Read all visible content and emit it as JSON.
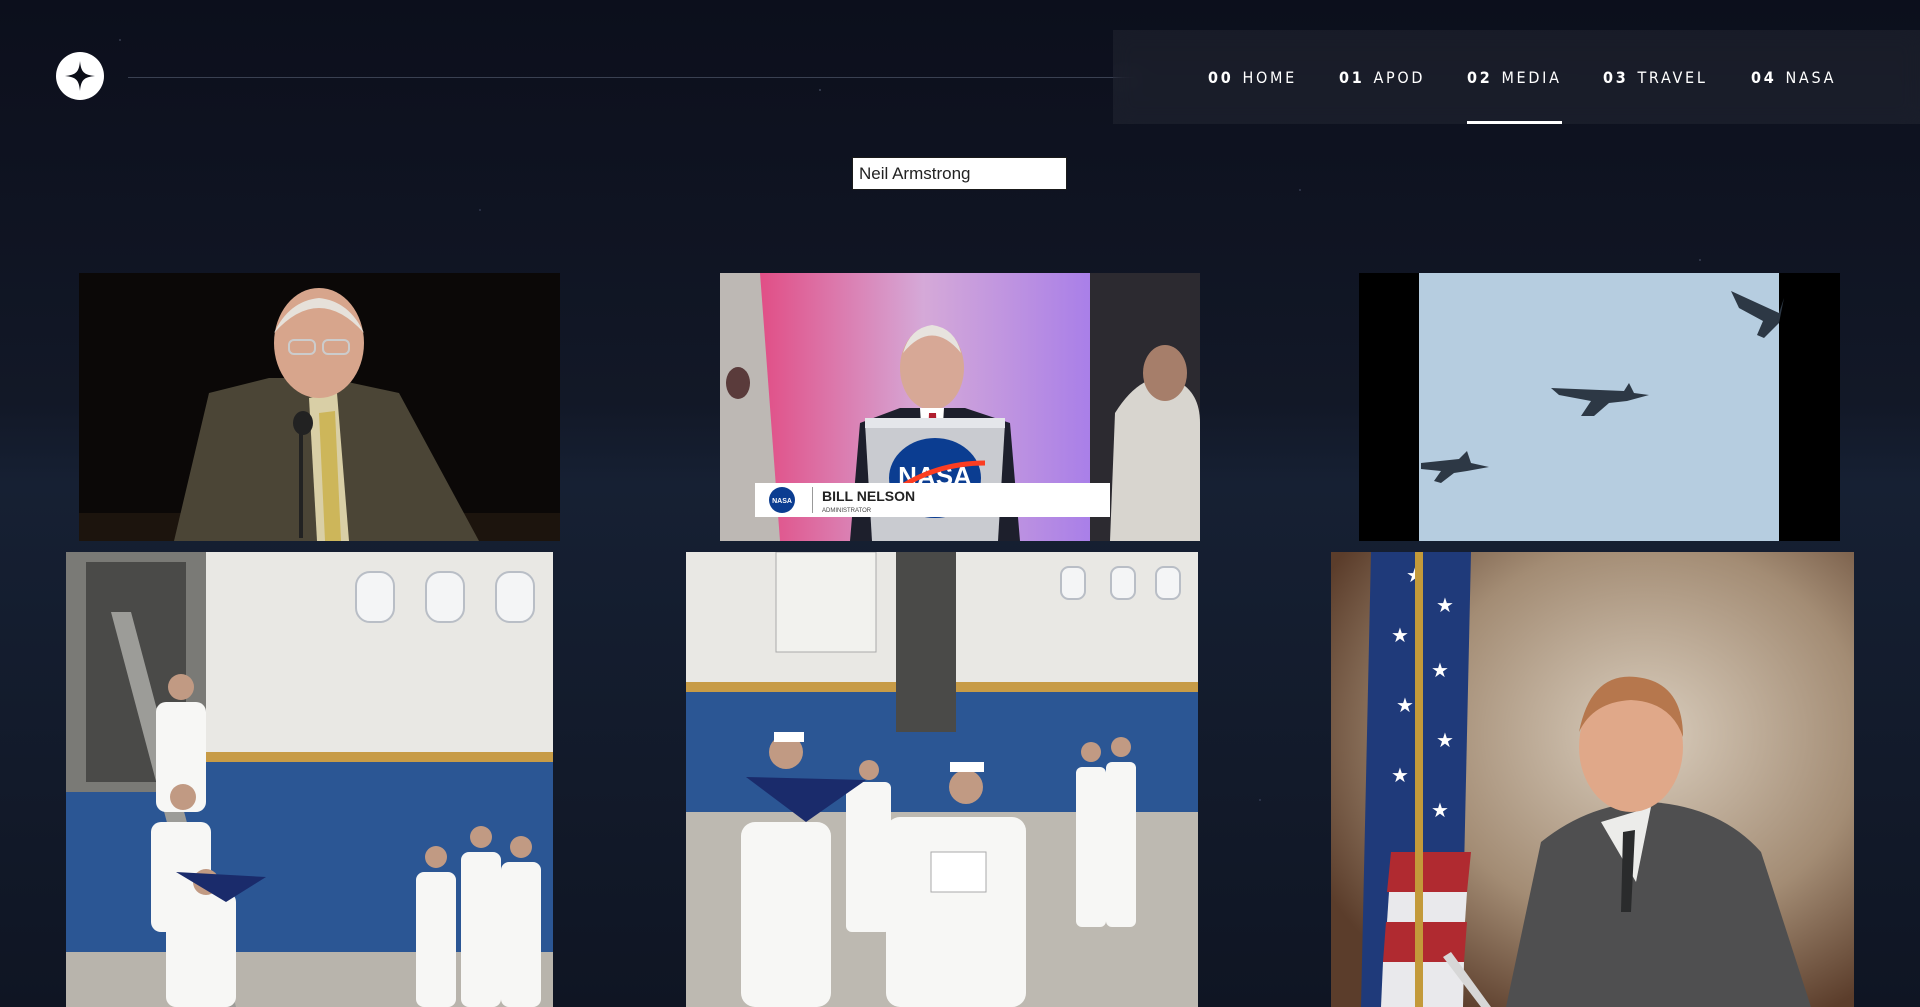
{
  "header": {
    "logo_icon": "compass-star-icon",
    "nav": [
      {
        "num": "00",
        "label": "HOME"
      },
      {
        "num": "01",
        "label": "APOD"
      },
      {
        "num": "02",
        "label": "MEDIA",
        "active": true
      },
      {
        "num": "03",
        "label": "TRAVEL"
      },
      {
        "num": "04",
        "label": "NASA"
      }
    ]
  },
  "search": {
    "value": "Neil Armstrong"
  },
  "media": [
    {
      "kind": "video-thumbnail",
      "subject": "speaker-at-podium"
    },
    {
      "kind": "video-thumbnail",
      "subject": "administrator-at-nasa-podium",
      "lower_third": {
        "name": "BILL NELSON",
        "title": "ADMINISTRATOR",
        "badge": "NASA"
      },
      "podium_logo": "NASA"
    },
    {
      "kind": "video-thumbnail",
      "subject": "jets-in-sky"
    },
    {
      "kind": "image",
      "subject": "honor-guard-descending-aircraft-stairs"
    },
    {
      "kind": "image",
      "subject": "honor-guard-carrying-flag"
    },
    {
      "kind": "image",
      "subject": "portrait-with-flag"
    }
  ],
  "colors": {
    "background": "#0b0d17",
    "nav_bg": "rgba(255,255,255,0.05)",
    "accent": "#ffffff"
  }
}
